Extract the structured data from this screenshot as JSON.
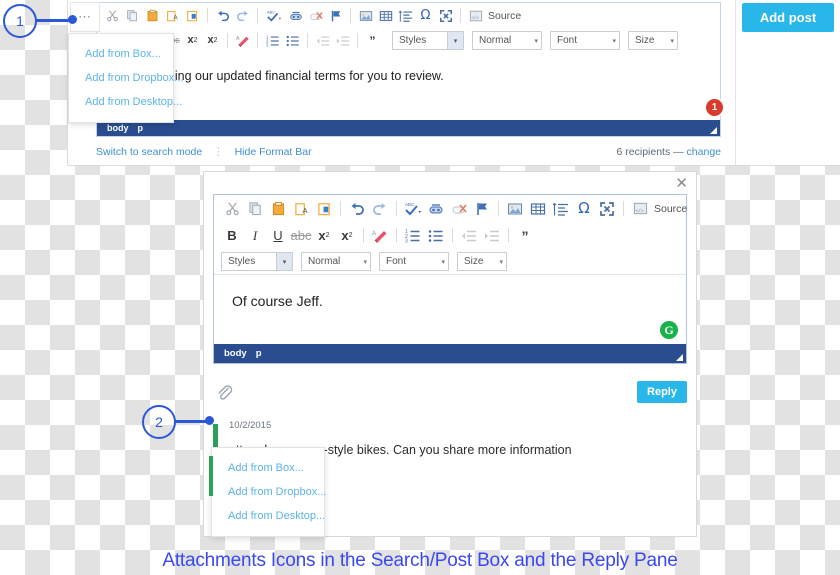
{
  "caption": "Attachments Icons in the Search/Post Box and the Reply Pane",
  "post_panel": {
    "attach_button_label": "⋯",
    "close_label": "✕",
    "toolbar_source_label": "Source",
    "selects": {
      "styles": "Styles",
      "format": "Normal",
      "font": "Font",
      "size": "Size"
    },
    "body_text": "I am attaching our updated financial terms for you to review.",
    "element_path": [
      "body",
      "p"
    ],
    "badge_count": "1",
    "footer": {
      "switch_mode": "Switch to search mode",
      "separator": "⋮",
      "hide_format_bar": "Hide Format Bar",
      "recipients": "6 recipients — ",
      "change": "change"
    },
    "add_post_label": "Add post",
    "attach_menu": [
      "Add from Box...",
      "Add from Dropbox...",
      "Add from Desktop..."
    ]
  },
  "reply_panel": {
    "close_label": "✕",
    "toolbar_source_label": "Source",
    "selects": {
      "styles": "Styles",
      "format": "Normal",
      "font": "Font",
      "size": "Size"
    },
    "body_text": "Of course Jeff.",
    "grammarly_label": "G",
    "element_path": [
      "body",
      "p"
    ],
    "reply_button_label": "Reply",
    "attach_menu": [
      "Add from Box...",
      "Add from Dropbox...",
      "Add from Desktop..."
    ],
    "thread": {
      "date": "10/2/2015",
      "message": "ett and european-style bikes. Can you share more information"
    }
  },
  "annotations": {
    "one": "1",
    "two": "2"
  },
  "colors": {
    "accent_cyan": "#29b6e8",
    "element_bar_blue": "#2a4d8f",
    "annotation_blue": "#2b58d6",
    "badge_red": "#d93a2b",
    "link_blue": "#3f8fd2",
    "menu_link_blue": "#5cb3e8",
    "caption_blue": "#3a48f0",
    "grammarly_green": "#15b34a"
  }
}
